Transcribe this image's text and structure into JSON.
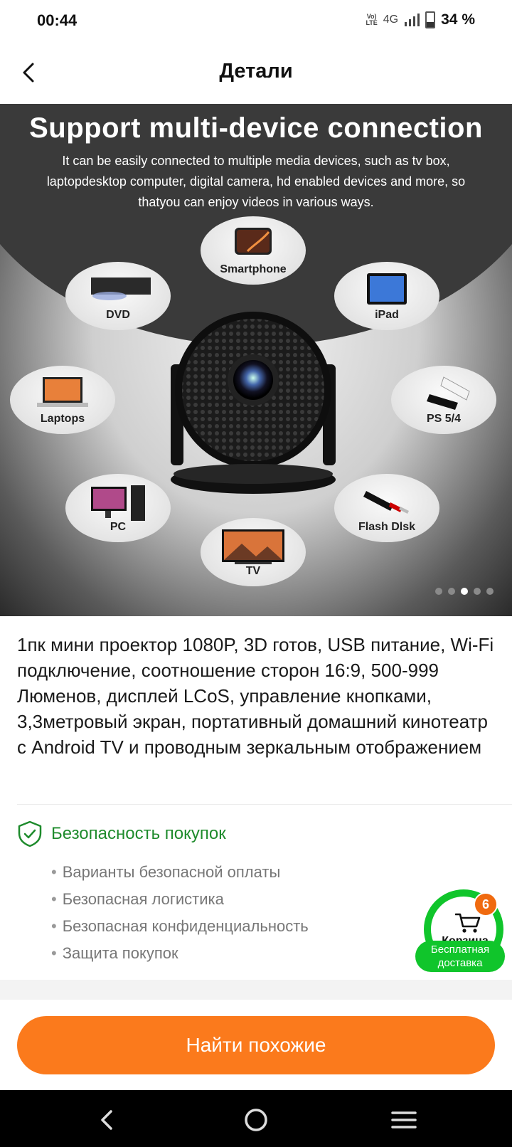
{
  "status": {
    "time": "00:44",
    "volte_top": "Vo)",
    "volte_bottom": "LTE",
    "network": "4G",
    "battery": "34 %"
  },
  "header": {
    "title": "Детали"
  },
  "hero": {
    "title": "Support multi-device connection",
    "subtitle": "It can be easily connected to multiple media devices, such as tv box, laptopdesktop computer, digital camera, hd enabled devices and more, so thatyou can enjoy videos in various ways.",
    "devices": [
      "Smartphone",
      "DVD",
      "iPad",
      "Laptops",
      "PS 5/4",
      "PC",
      "Flash Dlsk",
      "TV"
    ],
    "slide_count": 5,
    "active_slide": 3
  },
  "product": {
    "title": "1пк мини проектор 1080P, 3D готов, USB питание, Wi-Fi подключение, соотношение сторон 16:9, 500-999 Люменов, дисплей LCoS, управление кнопками, 3,3метровый экран, портативный домашний кинотеатр с Android TV и проводным зеркальным отображением"
  },
  "safety": {
    "title": "Безопасность покупок",
    "items": [
      "Варианты безопасной оплаты",
      "Безопасная логистика",
      "Безопасная конфиденциальность",
      "Защита покупок"
    ]
  },
  "cart": {
    "label": "Корзина",
    "count": "6",
    "shipping": "Бесплатная доставка"
  },
  "actions": {
    "find_similar": "Найти похожие"
  },
  "colors": {
    "accent_orange": "#fb7a1c",
    "safe_green": "#1e8b2c",
    "cart_green": "#10c52b"
  }
}
